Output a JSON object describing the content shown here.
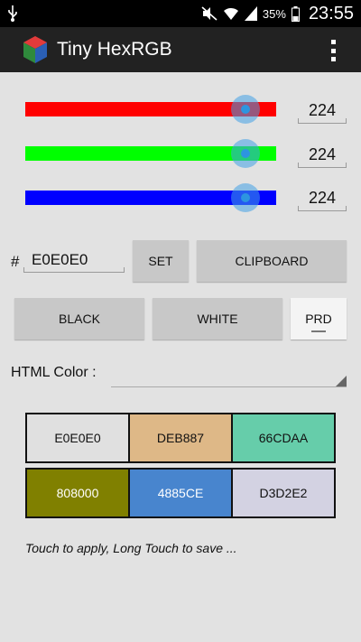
{
  "status_bar": {
    "battery_percent": "35%",
    "time": "23:55",
    "icons": [
      "usb-icon",
      "mute-icon",
      "wifi-icon",
      "signal-icon",
      "battery-icon"
    ]
  },
  "action_bar": {
    "title": "Tiny HexRGB",
    "icons": [
      "app-cube-icon",
      "overflow-menu-icon"
    ]
  },
  "sliders": [
    {
      "name": "red",
      "color": "#ff0000",
      "value": "224",
      "fraction": 0.878
    },
    {
      "name": "green",
      "color": "#00ff00",
      "value": "224",
      "fraction": 0.878
    },
    {
      "name": "blue",
      "color": "#0000ff",
      "value": "224",
      "fraction": 0.878
    }
  ],
  "hex_input": {
    "prefix": "#",
    "value": "E0E0E0"
  },
  "buttons": {
    "set": "SET",
    "clipboard": "CLIPBOARD",
    "black": "BLACK",
    "white": "WHITE",
    "prd": "PRD"
  },
  "html_color": {
    "label": "HTML Color :",
    "selected": ""
  },
  "swatches": [
    {
      "label": "E0E0E0",
      "bg": "#e0e0e0",
      "fg": "#111111"
    },
    {
      "label": "DEB887",
      "bg": "#deb887",
      "fg": "#111111"
    },
    {
      "label": "66CDAA",
      "bg": "#66cdaa",
      "fg": "#111111"
    },
    {
      "label": "808000",
      "bg": "#808000",
      "fg": "#ffffff"
    },
    {
      "label": "4885CE",
      "bg": "#4885ce",
      "fg": "#ffffff"
    },
    {
      "label": "D3D2E2",
      "bg": "#d3d2e2",
      "fg": "#111111"
    }
  ],
  "hint": "Touch to apply, Long Touch to save ..."
}
